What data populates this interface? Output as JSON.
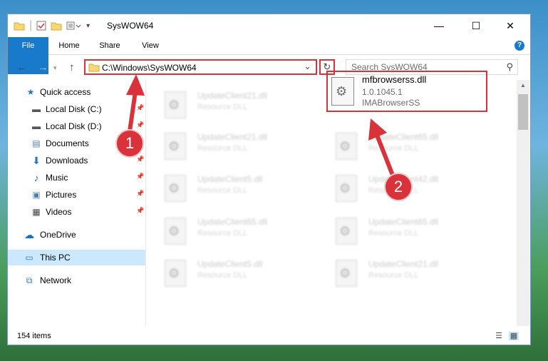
{
  "window": {
    "title": "SysWOW64"
  },
  "ribbon": {
    "tabs": [
      "File",
      "Home",
      "Share",
      "View"
    ],
    "help": "?"
  },
  "address": {
    "path": "C:\\Windows\\SysWOW64",
    "dropdown": "⌄",
    "refresh": "↻"
  },
  "search": {
    "placeholder": "Search SysWOW64"
  },
  "nav": {
    "back": "←",
    "forward": "→",
    "up": "↑",
    "items": [
      {
        "label": "Quick access",
        "icon": "star-icon",
        "pinned": false
      },
      {
        "label": "Local Disk (C:)",
        "icon": "drive-icon",
        "pinned": true
      },
      {
        "label": "Local Disk (D:)",
        "icon": "drive-icon",
        "pinned": true
      },
      {
        "label": "Documents",
        "icon": "documents-icon",
        "pinned": true
      },
      {
        "label": "Downloads",
        "icon": "download-icon",
        "pinned": true
      },
      {
        "label": "Music",
        "icon": "music-icon",
        "pinned": true
      },
      {
        "label": "Pictures",
        "icon": "pictures-icon",
        "pinned": true
      },
      {
        "label": "Videos",
        "icon": "videos-icon",
        "pinned": true
      },
      {
        "label": "OneDrive",
        "icon": "cloud-icon",
        "pinned": false
      },
      {
        "label": "This PC",
        "icon": "computer-icon",
        "pinned": false,
        "selected": true
      },
      {
        "label": "Network",
        "icon": "network-icon",
        "pinned": false
      }
    ]
  },
  "files": [
    {
      "name": "UpdateClient21.dll",
      "type": "Resource DLL"
    },
    {
      "name": "UpdateClient21.dll",
      "type": "Resource DLL"
    },
    {
      "name": "UpdateClient65.dll",
      "type": "Resource DLL"
    },
    {
      "name": "UpdateClient5.dll",
      "type": "Resource DLL"
    },
    {
      "name": "UpdateClient42.dll",
      "type": "Resource DLL"
    },
    {
      "name": "UpdateClient65.dll",
      "type": "Resource DLL"
    },
    {
      "name": "UpdateClient65.dll",
      "type": "Resource DLL"
    },
    {
      "name": "UpdateClient5.dll",
      "type": "Resource DLL"
    },
    {
      "name": "UpdateClient21.dll",
      "type": "Resource DLL"
    }
  ],
  "highlighted_file": {
    "name": "mfbrowserss.dll",
    "version": "1.0.1045.1",
    "description": "IMABrowserSS"
  },
  "annotations": {
    "marker1": "1",
    "marker2": "2",
    "color": "#d9323a"
  },
  "status": {
    "item_count": "154 items"
  }
}
